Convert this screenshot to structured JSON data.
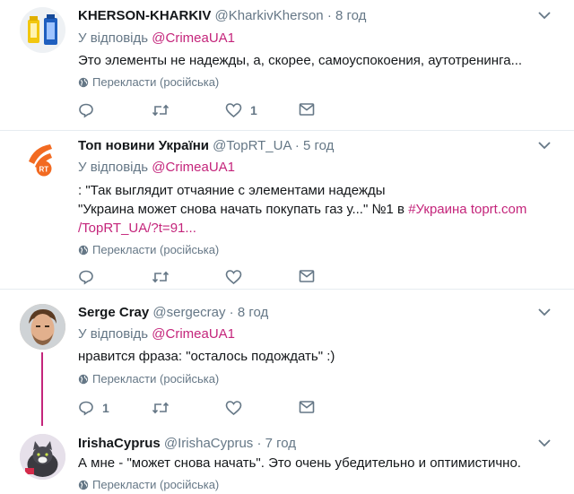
{
  "tweets": [
    {
      "name": "KHERSON-KHARKIV",
      "handle": "@KharkivKherson",
      "dot": "·",
      "time": "8 год",
      "reply_prefix": "У відповідь",
      "reply_to": "@CrimeaUA1",
      "lines": [
        "Это элементы не надежды, а, скорее, самоуспокоения, аутотренинга..."
      ],
      "translate": "Перекласти (російська)",
      "reply_count": "",
      "retweet_count": "",
      "like_count": "1"
    },
    {
      "name": "Топ новини України",
      "handle": "@TopRT_UA",
      "dot": "·",
      "time": "5 год",
      "reply_prefix": "У відповідь",
      "reply_to": "@CrimeaUA1",
      "line1": ": \"Так выглядит отчаяние с элементами надежды",
      "line2_text": "\"Украина может снова начать покупать газ у...\" №1 в ",
      "line2_hashtag": "#Украина",
      "line2_space": " ",
      "line2_link": "toprt.com",
      "line3_link": "/TopRT_UA/?t=91...",
      "translate": "Перекласти (російська)",
      "reply_count": "",
      "retweet_count": "",
      "like_count": ""
    },
    {
      "name": "Serge Cray",
      "handle": "@sergecray",
      "dot": "·",
      "time": "8 год",
      "reply_prefix": "У відповідь",
      "reply_to": "@CrimeaUA1",
      "lines": [
        "нравится фраза: \"осталось подождать\" :)"
      ],
      "translate": "Перекласти (російська)",
      "reply_count": "1",
      "retweet_count": "",
      "like_count": ""
    },
    {
      "name": "IrishaCyprus",
      "handle": "@IrishaCyprus",
      "dot": "·",
      "time": "7 год",
      "lines": [
        "А мне - \"может снова начать\".  Это очень убедительно и оптимистично."
      ],
      "translate": "Перекласти (російська)"
    }
  ],
  "colors": {
    "accent": "#c4257b",
    "muted": "#657786",
    "text": "#14171a",
    "divider": "#e6ecf0"
  }
}
